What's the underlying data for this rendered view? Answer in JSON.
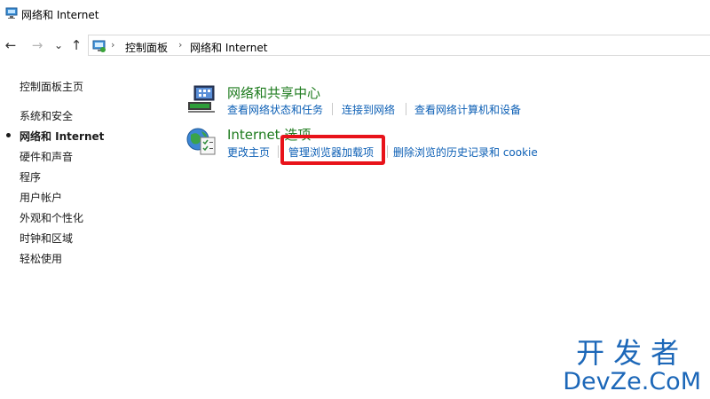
{
  "window": {
    "title": "网络和 Internet"
  },
  "nav": {
    "back": "←",
    "forward": "→",
    "recent": "⌄",
    "up": "↑"
  },
  "breadcrumb": [
    "控制面板",
    "网络和 Internet"
  ],
  "sidebar": {
    "items": [
      {
        "label": "控制面板主页"
      },
      {
        "label": "系统和安全"
      },
      {
        "label": "网络和 Internet",
        "active": true
      },
      {
        "label": "硬件和声音"
      },
      {
        "label": "程序"
      },
      {
        "label": "用户帐户"
      },
      {
        "label": "外观和个性化"
      },
      {
        "label": "时钟和区域"
      },
      {
        "label": "轻松使用"
      }
    ]
  },
  "categories": [
    {
      "title": "网络和共享中心",
      "icon": "network-sharing-center-icon",
      "links": [
        "查看网络状态和任务",
        "连接到网络",
        "查看网络计算机和设备"
      ]
    },
    {
      "title": "Internet 选项",
      "icon": "internet-options-icon",
      "links": [
        "更改主页",
        "管理浏览器加载项",
        "删除浏览的历史记录和 cookie"
      ]
    }
  ],
  "watermark": {
    "line1": "开发者",
    "line2": "DevZe.CoM"
  },
  "colors": {
    "link": "#0c5fb5",
    "category": "#1e7b1e",
    "highlight": "#e8131a",
    "watermark": "#1c67b8"
  }
}
